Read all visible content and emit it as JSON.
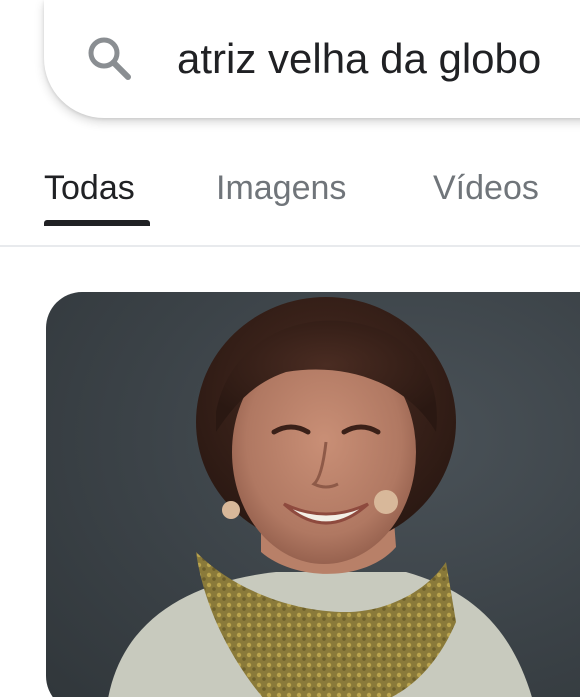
{
  "search": {
    "query": "atriz velha da globo",
    "icon": "search-icon"
  },
  "tabs": [
    {
      "label": "Todas",
      "active": true
    },
    {
      "label": "Imagens",
      "active": false
    },
    {
      "label": "Vídeos",
      "active": false
    }
  ],
  "colors": {
    "text_primary": "#202124",
    "text_secondary": "#70757a",
    "divider": "#e8eaed",
    "image_background": "#3b4247"
  }
}
